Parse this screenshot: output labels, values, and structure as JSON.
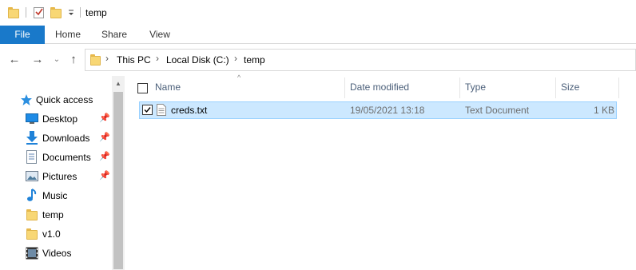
{
  "window": {
    "title": "temp"
  },
  "ribbon": {
    "tabs": [
      "File",
      "Home",
      "Share",
      "View"
    ]
  },
  "address": {
    "crumbs": [
      "This PC",
      "Local Disk (C:)",
      "temp"
    ]
  },
  "nav": {
    "quick_access": "Quick access",
    "items": [
      {
        "label": "Desktop",
        "icon": "desktop-icon",
        "pinned": true
      },
      {
        "label": "Downloads",
        "icon": "downloads-icon",
        "pinned": true
      },
      {
        "label": "Documents",
        "icon": "documents-icon",
        "pinned": true
      },
      {
        "label": "Pictures",
        "icon": "pictures-icon",
        "pinned": true
      },
      {
        "label": "Music",
        "icon": "music-icon",
        "pinned": false
      },
      {
        "label": "temp",
        "icon": "folder-icon",
        "pinned": false
      },
      {
        "label": "v1.0",
        "icon": "folder-icon",
        "pinned": false
      },
      {
        "label": "Videos",
        "icon": "videos-icon",
        "pinned": false
      }
    ]
  },
  "columns": {
    "name": "Name",
    "date": "Date modified",
    "type": "Type",
    "size": "Size"
  },
  "files": [
    {
      "name": "creds.txt",
      "date": "19/05/2021 13:18",
      "type": "Text Document",
      "size": "1 KB",
      "selected": true,
      "checked": true
    }
  ],
  "colors": {
    "file_tab": "#1979ca",
    "selection": "#cce8ff",
    "selection_border": "#99d1ff",
    "folder": "#f8d775"
  }
}
